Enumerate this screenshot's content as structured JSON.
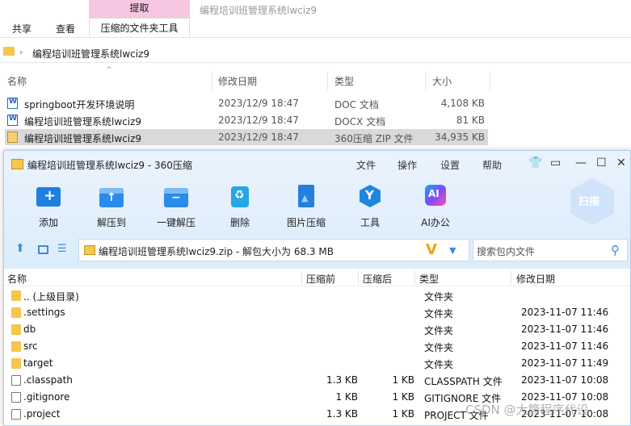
{
  "explorer": {
    "context_tab": "提取",
    "window_title": "编程培训班管理系统lwciz9",
    "tabs": [
      "共享",
      "查看",
      "压缩的文件夹工具"
    ],
    "address_path": "编程培训班管理系统lwciz9",
    "columns": [
      "名称",
      "修改日期",
      "类型",
      "大小"
    ],
    "rows": [
      {
        "name": "springboot开发环境说明",
        "date": "2023/12/9 18:47",
        "type": "DOC 文档",
        "size": "4,108 KB",
        "icon": "word-doc-icon"
      },
      {
        "name": "编程培训班管理系统lwciz9",
        "date": "2023/12/9 18:47",
        "type": "DOCX 文档",
        "size": "81 KB",
        "icon": "word-docx-icon"
      },
      {
        "name": "编程培训班管理系统lwciz9",
        "date": "2023/12/9 18:47",
        "type": "360压缩 ZIP 文件",
        "size": "34,935 KB",
        "icon": "zip-archive-icon"
      }
    ]
  },
  "zip_window": {
    "title": "编程培训班管理系统lwciz9 - 360压缩",
    "menu": [
      "文件",
      "操作",
      "设置",
      "帮助"
    ],
    "toolbar": [
      "添加",
      "解压到",
      "一键解压",
      "删除",
      "图片压缩",
      "工具",
      "AI办公"
    ],
    "scan_label": "扫描",
    "path_text": "编程培训班管理系统lwciz9.zip - 解包大小为 68.3 MB",
    "search_placeholder": "搜索包内文件",
    "columns": [
      "名称",
      "压缩前",
      "压缩后",
      "类型",
      "修改日期"
    ],
    "rows": [
      {
        "name": ".. (上级目录)",
        "before": "",
        "after": "",
        "type": "文件夹",
        "date": "",
        "kind": "folder"
      },
      {
        "name": ".settings",
        "before": "",
        "after": "",
        "type": "文件夹",
        "date": "2023-11-07 11:46",
        "kind": "folder"
      },
      {
        "name": "db",
        "before": "",
        "after": "",
        "type": "文件夹",
        "date": "2023-11-07 11:46",
        "kind": "folder"
      },
      {
        "name": "src",
        "before": "",
        "after": "",
        "type": "文件夹",
        "date": "2023-11-07 11:46",
        "kind": "folder"
      },
      {
        "name": "target",
        "before": "",
        "after": "",
        "type": "文件夹",
        "date": "2023-11-07 11:49",
        "kind": "folder"
      },
      {
        "name": ".classpath",
        "before": "1.3 KB",
        "after": "1 KB",
        "type": "CLASSPATH 文件",
        "date": "2023-11-07 10:08",
        "kind": "file"
      },
      {
        "name": ".gitignore",
        "before": "1 KB",
        "after": "1 KB",
        "type": "GITIGNORE 文件",
        "date": "2023-11-07 10:08",
        "kind": "file"
      },
      {
        "name": ".project",
        "before": "1.3 KB",
        "after": "1 KB",
        "type": "PROJECT 文件",
        "date": "2023-11-07 10:08",
        "kind": "file"
      }
    ]
  },
  "watermark": "CSDN @大筒程序代设"
}
